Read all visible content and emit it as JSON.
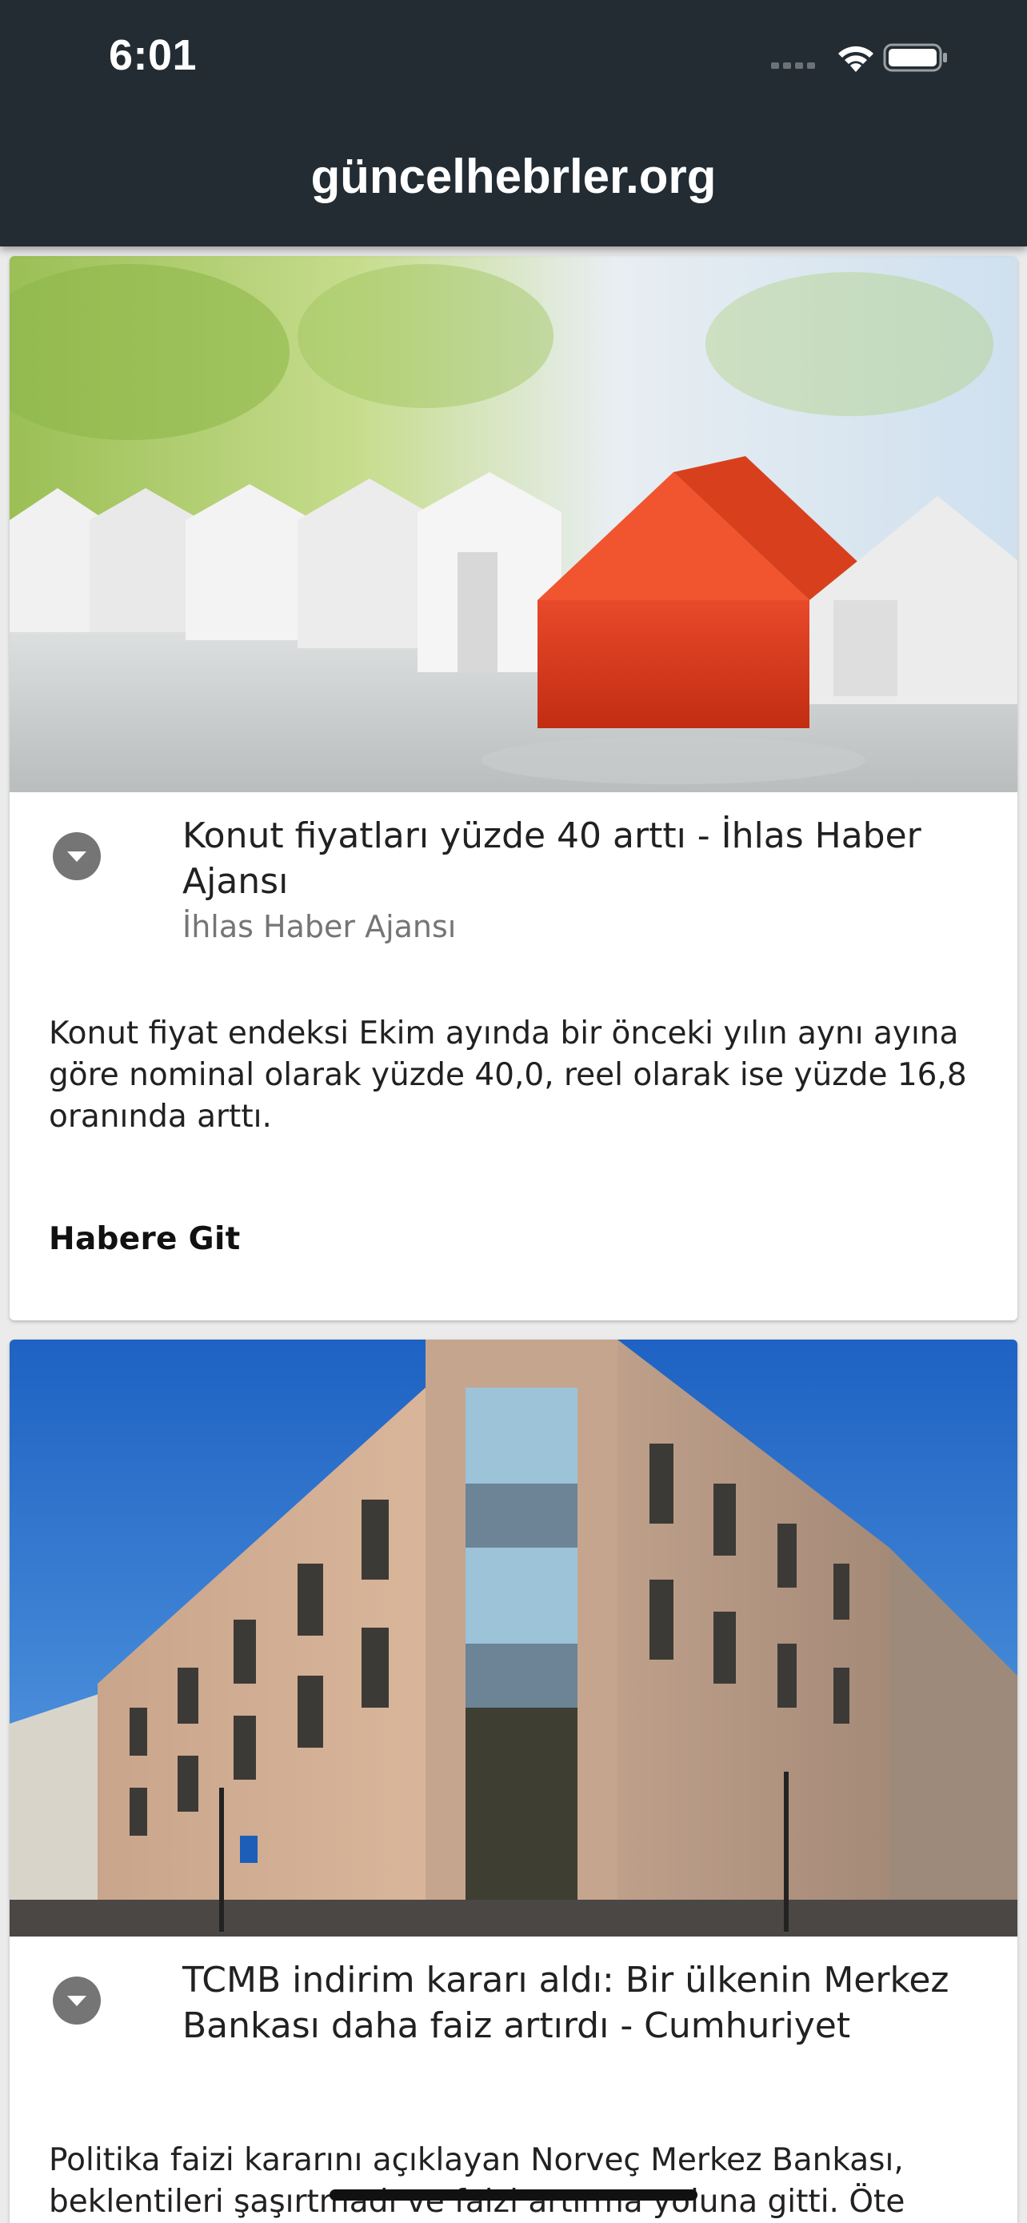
{
  "status_bar": {
    "time": "6:01",
    "icons": [
      "cellular-signal-icon",
      "wifi-icon",
      "battery-icon"
    ]
  },
  "app_bar": {
    "title": "güncelhebrler.org"
  },
  "articles": [
    {
      "image": "red-house-among-white-houses-photo",
      "title": "Konut fiyatları yüzde 40 arttı - İhlas Haber Ajansı",
      "source": "İhlas Haber Ajansı",
      "description": "Konut fiyat endeksi Ekim ayında bir önceki yılın aynı ayına göre nominal olarak yüzde 40,0, reel olarak ise yüzde 16,8 oranında arttı.",
      "action_label": "Habere Git"
    },
    {
      "image": "central-bank-building-photo",
      "title": "TCMB indirim kararı aldı: Bir ülkenin Merkez Bankası daha faiz artırdı - Cumhuriyet",
      "source": "",
      "description": "Politika faizi kararını açıklayan Norveç Merkez Bankası, beklentileri şaşırtmadı ve faizi artırma yoluna gitti. Öte",
      "action_label": ""
    }
  ],
  "colors": {
    "app_bar_bg": "#232c33",
    "feed_bg": "#ebebeb",
    "card_bg": "#ffffff",
    "expand_button": "#757575",
    "house_red": "#e0411e"
  }
}
